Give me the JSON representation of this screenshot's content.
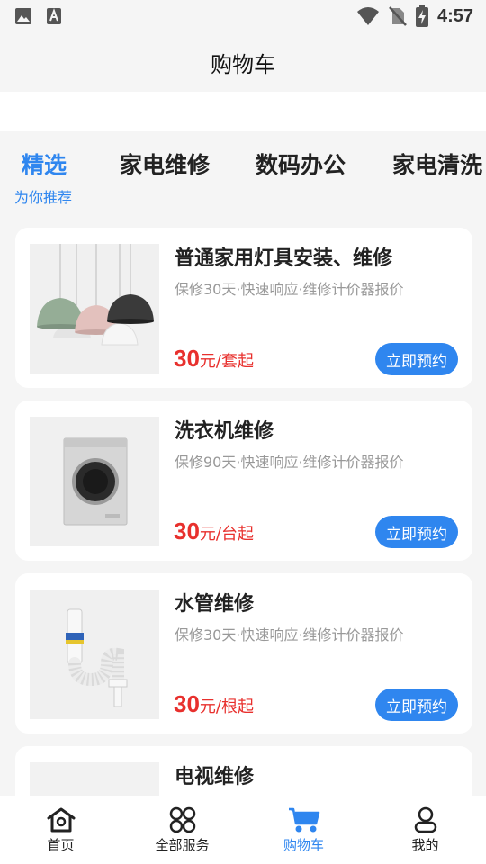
{
  "status_bar": {
    "time": "4:57",
    "icons": [
      "image-icon",
      "text-a-icon",
      "wifi-icon",
      "no-sim-icon",
      "battery-charging-icon"
    ]
  },
  "header": {
    "title": "购物车"
  },
  "tabs": {
    "items": [
      {
        "label": "精选",
        "active": true
      },
      {
        "label": "家电维修",
        "active": false
      },
      {
        "label": "数码办公",
        "active": false
      },
      {
        "label": "家电清洗",
        "active": false
      }
    ],
    "active_subtitle": "为你推荐"
  },
  "products": [
    {
      "title": "普通家用灯具安装、维修",
      "subtitle": "保修30天·快速响应·维修计价器报价",
      "price": "30",
      "unit": "元/套起",
      "button": "立即预约",
      "image": "pendant-lamps-image"
    },
    {
      "title": "洗衣机维修",
      "subtitle": "保修90天·快速响应·维修计价器报价",
      "price": "30",
      "unit": "元/台起",
      "button": "立即预约",
      "image": "washing-machine-image"
    },
    {
      "title": "水管维修",
      "subtitle": "保修30天·快速响应·维修计价器报价",
      "price": "30",
      "unit": "元/根起",
      "button": "立即预约",
      "image": "drain-pipe-image"
    },
    {
      "title": "电视维修",
      "image": "tv-image"
    }
  ],
  "bottom_nav": [
    {
      "label": "首页",
      "icon": "home-icon",
      "active": false
    },
    {
      "label": "全部服务",
      "icon": "grid-icon",
      "active": false
    },
    {
      "label": "购物车",
      "icon": "cart-icon",
      "active": true
    },
    {
      "label": "我的",
      "icon": "user-icon",
      "active": false
    }
  ],
  "colors": {
    "accent": "#2f86ef",
    "price": "#e8302d",
    "background": "#f5f5f5"
  }
}
